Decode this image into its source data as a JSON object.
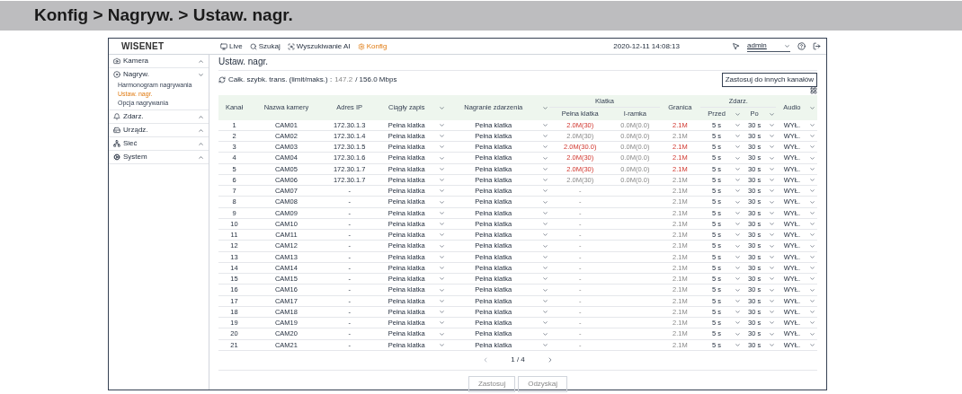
{
  "breadcrumb": "Konfig > Nagryw. > Ustaw. nagr.",
  "topbar": {
    "logo": "WISENET",
    "nav": [
      {
        "label": "Live",
        "selected": false
      },
      {
        "label": "Szukaj",
        "selected": false
      },
      {
        "label": "Wyszukiwanie AI",
        "selected": false
      },
      {
        "label": "Konfig",
        "selected": true
      }
    ],
    "datetime": "2020-12-11 14:08:13",
    "user": "admin"
  },
  "sidebar": [
    {
      "label": "Kamera",
      "expanded": false
    },
    {
      "label": "Nagryw.",
      "expanded": true,
      "children": [
        {
          "label": "Harmonogram nagrywania",
          "selected": false
        },
        {
          "label": "Ustaw. nagr.",
          "selected": true
        },
        {
          "label": "Opcja nagrywania",
          "selected": false
        }
      ]
    },
    {
      "label": "Zdarz.",
      "expanded": false
    },
    {
      "label": "Urządz.",
      "expanded": false
    },
    {
      "label": "Sieć",
      "expanded": false
    },
    {
      "label": "System",
      "expanded": false
    }
  ],
  "page_title": "Ustaw. nagr.",
  "bitrate": {
    "label": "Całk. szybk. trans. (limit/maks.) :",
    "current": "147.2",
    "max": "/ 156.0 Mbps"
  },
  "apply_other_button": "Zastosuj do innych kanałów",
  "table": {
    "columns": [
      "Kanał",
      "Nazwa kamery",
      "Adres IP",
      "Ciągły zapis",
      "Nagranie zdarzenia",
      "Klatka",
      "Pełna klatka",
      "I-ramka",
      "Granica",
      "Zdarz.",
      "Przed",
      "Po",
      "Audio"
    ],
    "rows": [
      {
        "channel": "1",
        "name": "CAM01",
        "ip": "172.30.1.3",
        "continuous": "Pełna klatka",
        "event": "Pełna klatka",
        "full": "2.0M(30)",
        "iframe": "0.0M(0.0)",
        "limit": "2.1M",
        "over": true,
        "before": "5 s",
        "after": "30 s",
        "audio": "WYŁ."
      },
      {
        "channel": "2",
        "name": "CAM02",
        "ip": "172.30.1.4",
        "continuous": "Pełna klatka",
        "event": "Pełna klatka",
        "full": "2.0M(30)",
        "iframe": "0.0M(0.0)",
        "limit": "2.1M",
        "over": false,
        "before": "5 s",
        "after": "30 s",
        "audio": "WYŁ."
      },
      {
        "channel": "3",
        "name": "CAM03",
        "ip": "172.30.1.5",
        "continuous": "Pełna klatka",
        "event": "Pełna klatka",
        "full": "2.0M(30.0)",
        "iframe": "0.0M(0.0)",
        "limit": "2.1M",
        "over": true,
        "before": "5 s",
        "after": "30 s",
        "audio": "WYŁ."
      },
      {
        "channel": "4",
        "name": "CAM04",
        "ip": "172.30.1.6",
        "continuous": "Pełna klatka",
        "event": "Pełna klatka",
        "full": "2.0M(30)",
        "iframe": "0.0M(0.0)",
        "limit": "2.1M",
        "over": true,
        "before": "5 s",
        "after": "30 s",
        "audio": "WYŁ."
      },
      {
        "channel": "5",
        "name": "CAM05",
        "ip": "172.30.1.7",
        "continuous": "Pełna klatka",
        "event": "Pełna klatka",
        "full": "2.0M(30)",
        "iframe": "0.0M(0.0)",
        "limit": "2.1M",
        "over": true,
        "before": "5 s",
        "after": "30 s",
        "audio": "WYŁ."
      },
      {
        "channel": "6",
        "name": "CAM06",
        "ip": "172.30.1.7",
        "continuous": "Pełna klatka",
        "event": "Pełna klatka",
        "full": "2.0M(30)",
        "iframe": "0.0M(0.0)",
        "limit": "2.1M",
        "over": false,
        "before": "5 s",
        "after": "30 s",
        "audio": "WYŁ."
      },
      {
        "channel": "7",
        "name": "CAM07",
        "ip": "-",
        "continuous": "Pełna klatka",
        "event": "Pełna klatka",
        "full": "-",
        "limit": "2.1M",
        "over": false,
        "before": "5 s",
        "after": "30 s",
        "audio": "WYŁ."
      },
      {
        "channel": "8",
        "name": "CAM08",
        "ip": "-",
        "continuous": "Pełna klatka",
        "event": "Pełna klatka",
        "full": "-",
        "limit": "2.1M",
        "over": false,
        "before": "5 s",
        "after": "30 s",
        "audio": "WYŁ."
      },
      {
        "channel": "9",
        "name": "CAM09",
        "ip": "-",
        "continuous": "Pełna klatka",
        "event": "Pełna klatka",
        "full": "-",
        "limit": "2.1M",
        "over": false,
        "before": "5 s",
        "after": "30 s",
        "audio": "WYŁ."
      },
      {
        "channel": "10",
        "name": "CAM10",
        "ip": "-",
        "continuous": "Pełna klatka",
        "event": "Pełna klatka",
        "full": "-",
        "limit": "2.1M",
        "over": false,
        "before": "5 s",
        "after": "30 s",
        "audio": "WYŁ."
      },
      {
        "channel": "11",
        "name": "CAM11",
        "ip": "-",
        "continuous": "Pełna klatka",
        "event": "Pełna klatka",
        "full": "-",
        "limit": "2.1M",
        "over": false,
        "before": "5 s",
        "after": "30 s",
        "audio": "WYŁ."
      },
      {
        "channel": "12",
        "name": "CAM12",
        "ip": "-",
        "continuous": "Pełna klatka",
        "event": "Pełna klatka",
        "full": "-",
        "limit": "2.1M",
        "over": false,
        "before": "5 s",
        "after": "30 s",
        "audio": "WYŁ."
      },
      {
        "channel": "13",
        "name": "CAM13",
        "ip": "-",
        "continuous": "Pełna klatka",
        "event": "Pełna klatka",
        "full": "-",
        "limit": "2.1M",
        "over": false,
        "before": "5 s",
        "after": "30 s",
        "audio": "WYŁ."
      },
      {
        "channel": "14",
        "name": "CAM14",
        "ip": "-",
        "continuous": "Pełna klatka",
        "event": "Pełna klatka",
        "full": "-",
        "limit": "2.1M",
        "over": false,
        "before": "5 s",
        "after": "30 s",
        "audio": "WYŁ."
      },
      {
        "channel": "15",
        "name": "CAM15",
        "ip": "-",
        "continuous": "Pełna klatka",
        "event": "Pełna klatka",
        "full": "-",
        "limit": "2.1M",
        "over": false,
        "before": "5 s",
        "after": "30 s",
        "audio": "WYŁ."
      },
      {
        "channel": "16",
        "name": "CAM16",
        "ip": "-",
        "continuous": "Pełna klatka",
        "event": "Pełna klatka",
        "full": "-",
        "limit": "2.1M",
        "over": false,
        "before": "5 s",
        "after": "30 s",
        "audio": "WYŁ."
      },
      {
        "channel": "17",
        "name": "CAM17",
        "ip": "-",
        "continuous": "Pełna klatka",
        "event": "Pełna klatka",
        "full": "-",
        "limit": "2.1M",
        "over": false,
        "before": "5 s",
        "after": "30 s",
        "audio": "WYŁ."
      },
      {
        "channel": "18",
        "name": "CAM18",
        "ip": "-",
        "continuous": "Pełna klatka",
        "event": "Pełna klatka",
        "full": "-",
        "limit": "2.1M",
        "over": false,
        "before": "5 s",
        "after": "30 s",
        "audio": "WYŁ."
      },
      {
        "channel": "19",
        "name": "CAM19",
        "ip": "-",
        "continuous": "Pełna klatka",
        "event": "Pełna klatka",
        "full": "-",
        "limit": "2.1M",
        "over": false,
        "before": "5 s",
        "after": "30 s",
        "audio": "WYŁ."
      },
      {
        "channel": "20",
        "name": "CAM20",
        "ip": "-",
        "continuous": "Pełna klatka",
        "event": "Pełna klatka",
        "full": "-",
        "limit": "2.1M",
        "over": false,
        "before": "5 s",
        "after": "30 s",
        "audio": "WYŁ."
      },
      {
        "channel": "21",
        "name": "CAM21",
        "ip": "-",
        "continuous": "Pełna klatka",
        "event": "Pełna klatka",
        "full": "-",
        "limit": "2.1M",
        "over": false,
        "before": "5 s",
        "after": "30 s",
        "audio": "WYŁ."
      }
    ]
  },
  "pagination": {
    "page": "1 / 4"
  },
  "buttons": [
    {
      "label": "Zastosuj",
      "disabled": true
    },
    {
      "label": "Odzyskaj",
      "disabled": true
    }
  ]
}
